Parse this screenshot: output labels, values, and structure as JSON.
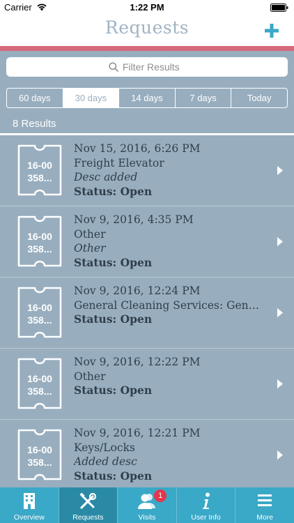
{
  "status_bar": {
    "carrier": "Carrier",
    "time": "1:22 PM"
  },
  "nav": {
    "title": "Requests",
    "add_icon": "plus-icon"
  },
  "filter": {
    "placeholder": "Filter Results",
    "icon": "search-icon"
  },
  "segments": [
    {
      "label": "60 days",
      "active": false
    },
    {
      "label": "30 days",
      "active": true
    },
    {
      "label": "14 days",
      "active": false
    },
    {
      "label": "7 days",
      "active": false
    },
    {
      "label": "Today",
      "active": false
    }
  ],
  "results_count": "8 Results",
  "requests": [
    {
      "ticket_line1": "16-00",
      "ticket_line2": "358...",
      "date": "Nov 15, 2016, 6:26 PM",
      "type": "Freight Elevator",
      "description": "Desc added",
      "status": "Status: Open"
    },
    {
      "ticket_line1": "16-00",
      "ticket_line2": "358...",
      "date": "Nov 9, 2016, 4:35 PM",
      "type": "Other",
      "description": "Other",
      "status": "Status: Open"
    },
    {
      "ticket_line1": "16-00",
      "ticket_line2": "358...",
      "date": "Nov 9, 2016, 12:24 PM",
      "type": "General Cleaning Services: Gen…",
      "description": "",
      "status": "Status: Open"
    },
    {
      "ticket_line1": "16-00",
      "ticket_line2": "358...",
      "date": "Nov 9, 2016, 12:22 PM",
      "type": "Other",
      "description": "",
      "status": "Status: Open"
    },
    {
      "ticket_line1": "16-00",
      "ticket_line2": "358...",
      "date": "Nov 9, 2016, 12:21 PM",
      "type": "Keys/Locks",
      "description": "Added desc",
      "status": "Status: Open"
    }
  ],
  "tabs": [
    {
      "label": "Overview",
      "icon": "building-icon",
      "active": false
    },
    {
      "label": "Requests",
      "icon": "tools-icon",
      "active": true
    },
    {
      "label": "Visits",
      "icon": "people-icon",
      "active": false,
      "badge": "1"
    },
    {
      "label": "User Info",
      "icon": "info-icon",
      "active": false
    },
    {
      "label": "More",
      "icon": "menu-icon",
      "active": false
    }
  ],
  "colors": {
    "background": "#98aebf",
    "accent_stripe": "#d5697b",
    "tab_bar": "#3aa8c7",
    "tab_active": "#2a8aa6",
    "add_button": "#3aa8c7",
    "badge": "#e5364b"
  }
}
